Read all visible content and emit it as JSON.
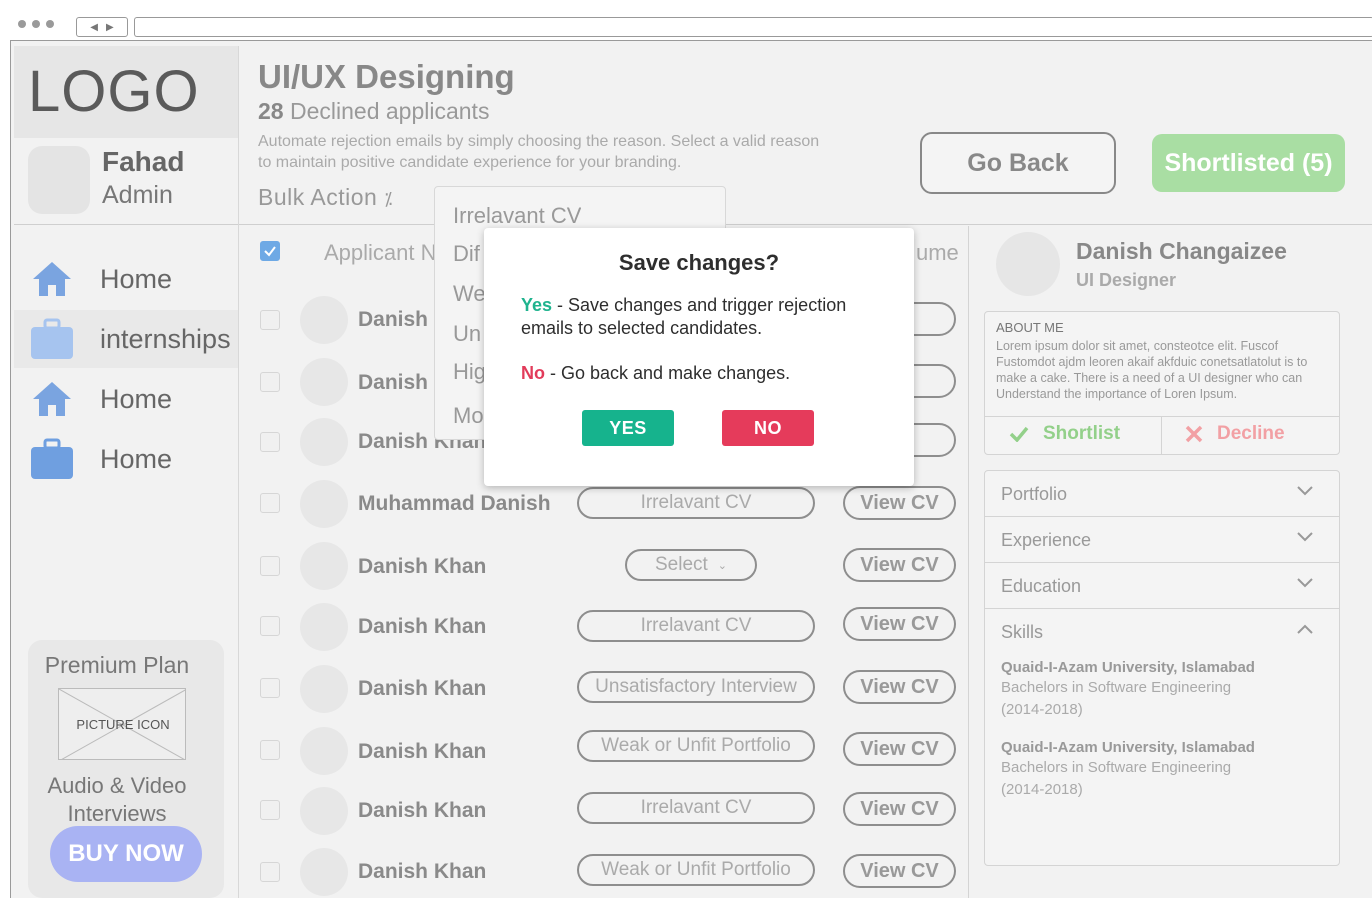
{
  "sidebar": {
    "logo": "LOGO",
    "admin_name": "Fahad",
    "admin_role": "Admin",
    "nav": [
      {
        "label": "Home",
        "icon": "home-icon"
      },
      {
        "label": "internships",
        "icon": "briefcase-icon"
      },
      {
        "label": "Home",
        "icon": "home-icon"
      },
      {
        "label": "Home",
        "icon": "briefcase-icon"
      }
    ],
    "premium": {
      "title": "Premium Plan",
      "picture_label": "PICTURE ICON",
      "subtitle_line1": "Audio & Video",
      "subtitle_line2": "Interviews",
      "buy": "BUY NOW"
    }
  },
  "header": {
    "title": "UI/UX Designing",
    "declined_count": "28",
    "declined_label": "Declined applicants",
    "helper_line1": "Automate rejection emails by simply choosing the reason. Select a valid reason",
    "helper_line2": "to maintain positive candidate experience for your branding.",
    "bulk_action": "Bulk Action",
    "go_back": "Go Back",
    "shortlisted": "Shortlisted (5)"
  },
  "bulk_dropdown": {
    "options": [
      "Irrelavant CV",
      "Dif",
      "We",
      "Un",
      "Hig",
      "Mo"
    ]
  },
  "table": {
    "headers": {
      "name": "Applicant N",
      "resume": "ume"
    },
    "rows": [
      {
        "name": "Danish",
        "reason": "",
        "view": "CV"
      },
      {
        "name": "Danish",
        "reason": "",
        "view": "CV"
      },
      {
        "name": "Danish Khan",
        "reason": "",
        "view": "CV"
      },
      {
        "name": "Muhammad Danish",
        "reason": "Irrelavant CV",
        "view": "View CV"
      },
      {
        "name": "Danish Khan",
        "reason": "Select",
        "view": "View CV"
      },
      {
        "name": "Danish Khan",
        "reason": "Irrelavant CV",
        "view": "View CV"
      },
      {
        "name": "Danish Khan",
        "reason": "Unsatisfactory Interview",
        "view": "View CV"
      },
      {
        "name": "Danish Khan",
        "reason": "Weak or Unfit Portfolio",
        "view": "View CV"
      },
      {
        "name": "Danish Khan",
        "reason": "Irrelavant CV",
        "view": "View CV"
      },
      {
        "name": "Danish Khan",
        "reason": "Weak or Unfit Portfolio",
        "view": "View CV"
      }
    ]
  },
  "candidate": {
    "name": "Danish Changaizee",
    "title": "UI Designer",
    "about_title": "ABOUT ME",
    "about_text": "Lorem ipsum dolor sit amet, consteotce elit. Fuscof Fustomdot ajdm leoren akaif akfduic conetsatlatolut is to make a cake. There is a need of a UI designer who can Understand the importance of Loren Ipsum.",
    "shortlist": "Shortlist",
    "decline": "Decline",
    "sections": [
      "Portfolio",
      "Experience",
      "Education",
      "Skills"
    ],
    "education": [
      {
        "university": "Quaid-I-Azam University, Islamabad",
        "degree": "Bachelors in Software Engineering",
        "years": "(2014-2018)"
      },
      {
        "university": "Quaid-I-Azam University, Islamabad",
        "degree": "Bachelors in Software Engineering",
        "years": "(2014-2018)"
      }
    ]
  },
  "modal": {
    "title": "Save changes?",
    "yes_key": "Yes",
    "yes_text": " - Save changes and trigger rejection emails to selected candidates.",
    "no_key": "No",
    "no_text": " - Go back and make changes.",
    "yes_button": "YES",
    "no_button": "NO"
  },
  "colors": {
    "home_icon": "#7aa4e0",
    "briefcase_icon": "#a6c4ef",
    "briefcase_dark": "#6f9fe0",
    "shortlisted": "#a9dea3",
    "buy_now": "#a9b3f3",
    "yes": "#16b38d",
    "no": "#e53b5b"
  }
}
